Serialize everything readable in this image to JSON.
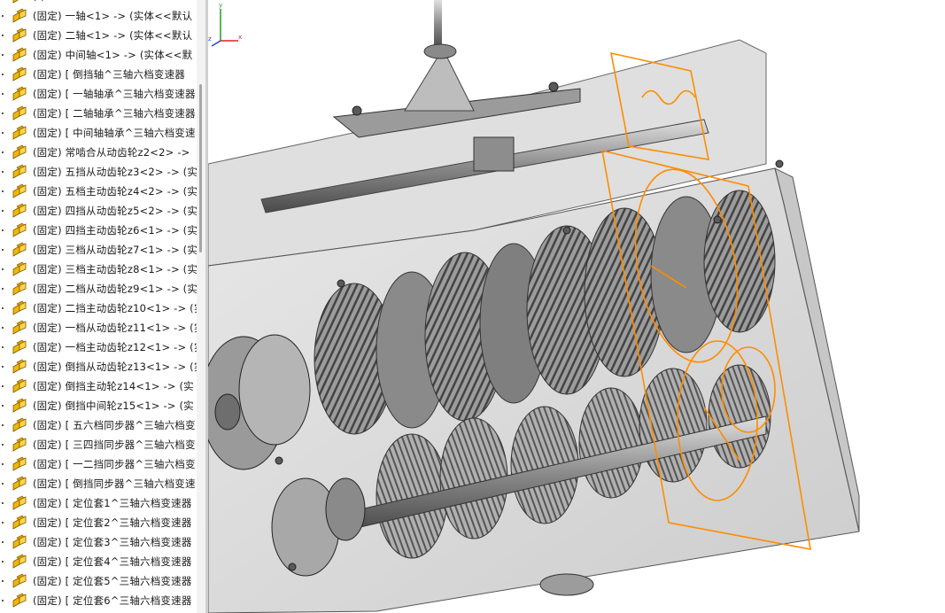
{
  "feature_tree": {
    "items": [
      {
        "text": "(-)"
      },
      {
        "text": "(固定) 一轴<1> -> (实体<<默认"
      },
      {
        "text": "(固定) 二轴<1> -> (实体<<默认"
      },
      {
        "text": "(固定) 中间轴<1> -> (实体<<默"
      },
      {
        "text": "(固定) [ 倒挡轴^三轴六档变速器"
      },
      {
        "text": "(固定) [ 一轴轴承^三轴六档变速器"
      },
      {
        "text": "(固定) [ 二轴轴承^三轴六档变速器"
      },
      {
        "text": "(固定) [ 中间轴轴承^三轴六档变速"
      },
      {
        "text": "(固定) 常啮合从动齿轮z2<2> ->"
      },
      {
        "text": "(固定) 五挡从动齿轮z3<2> -> (实"
      },
      {
        "text": "(固定) 五档主动齿轮z4<2> -> (实"
      },
      {
        "text": "(固定) 四挡从动齿轮z5<2> -> (实"
      },
      {
        "text": "(固定) 四挡主动齿轮z6<1> -> (实"
      },
      {
        "text": "(固定) 三档从动齿轮z7<1> -> (实"
      },
      {
        "text": "(固定) 三档主动齿轮z8<1> -> (实"
      },
      {
        "text": "(固定) 二档从动齿轮z9<1> -> (实"
      },
      {
        "text": "(固定) 二挡主动齿轮z10<1> -> (实"
      },
      {
        "text": "(固定) 一档从动齿轮z11<1> -> (实"
      },
      {
        "text": "(固定) 一档主动齿轮z12<1> -> (实"
      },
      {
        "text": "(固定) 倒挡从动齿轮z13<1> -> (实"
      },
      {
        "text": "(固定) 倒挡主动轮z14<1> -> (实"
      },
      {
        "text": "(固定) 倒挡中间轮z15<1> -> (实"
      },
      {
        "text": "(固定) [ 五六档同步器^三轴六档变"
      },
      {
        "text": "(固定) [ 三四挡同步器^三轴六档变"
      },
      {
        "text": "(固定) [ 一二挡同步器^三轴六档变"
      },
      {
        "text": "(固定) [ 倒挡同步器^三轴六档变速"
      },
      {
        "text": "(固定) [ 定位套1^三轴六档变速器"
      },
      {
        "text": "(固定) [ 定位套2^三轴六档变速器"
      },
      {
        "text": "(固定) [ 定位套3^三轴六档变速器"
      },
      {
        "text": "(固定) [ 定位套4^三轴六档变速器"
      },
      {
        "text": "(固定) [ 定位套5^三轴六档变速器"
      },
      {
        "text": "(固定) [ 定位套6^三轴六档变速器"
      }
    ]
  },
  "viewport": {
    "triad": {
      "x_label": "x",
      "y_label": "y",
      "z_label": "z"
    }
  },
  "colors": {
    "tree_icon": "#f2b705",
    "selection": "#ff8c00",
    "housing": "#b8b8b8",
    "triad_x": "#e02020",
    "triad_y": "#20a020",
    "triad_z": "#2040e0"
  },
  "icons": {
    "part": "assembly-part-icon"
  }
}
